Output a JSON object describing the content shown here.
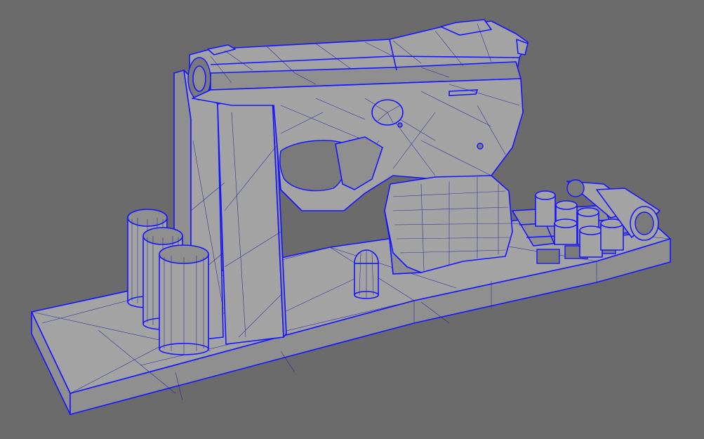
{
  "viewport": {
    "background_color": "#6b6b6b",
    "mesh_fill_color": "#a3a3a3",
    "mesh_fill_dark_color": "#8f8f8f",
    "wireframe_color": "#1515ff",
    "scene_content": [
      "pistol",
      "display-stand-base",
      "back-panel",
      "magazine-cylinders",
      "bullet-rack",
      "standing-bullet",
      "bullet-cartridges"
    ]
  }
}
